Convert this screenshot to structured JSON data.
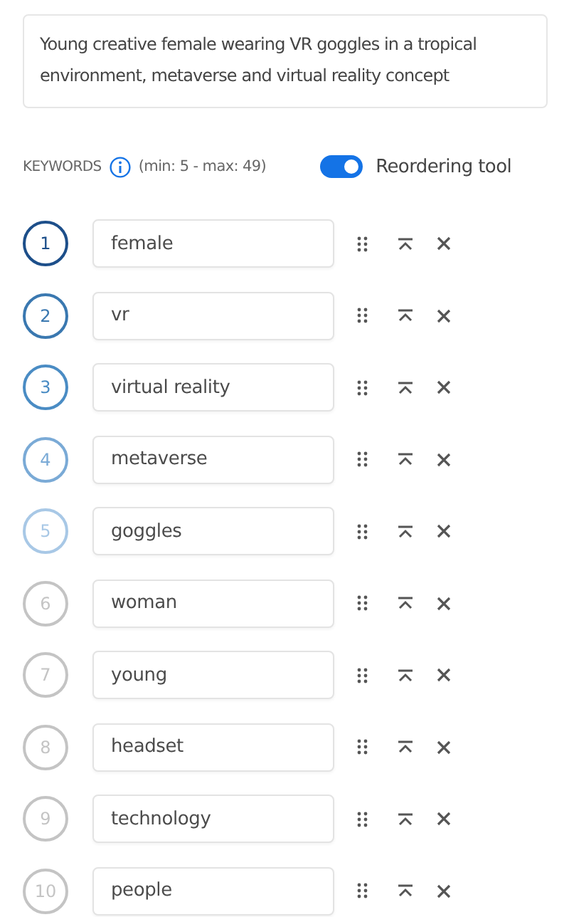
{
  "description": "Young creative female wearing VR goggles in a tropical environment, metaverse and virtual reality concept",
  "keywords_header": {
    "label": "KEYWORDS",
    "limits": "(min: 5 - max: 49)"
  },
  "reordering_tool": {
    "label": "Reordering tool",
    "on": true
  },
  "keywords": [
    {
      "number": "1",
      "value": "female",
      "color": "#1d4f8a"
    },
    {
      "number": "2",
      "value": "vr",
      "color": "#3a78b0"
    },
    {
      "number": "3",
      "value": "virtual reality",
      "color": "#4a8cc4"
    },
    {
      "number": "4",
      "value": "metaverse",
      "color": "#7aaad6"
    },
    {
      "number": "5",
      "value": "goggles",
      "color": "#a8c8e6"
    },
    {
      "number": "6",
      "value": "woman",
      "color": "#c4c4c4"
    },
    {
      "number": "7",
      "value": "young",
      "color": "#c4c4c4"
    },
    {
      "number": "8",
      "value": "headset",
      "color": "#c4c4c4"
    },
    {
      "number": "9",
      "value": "technology",
      "color": "#c4c4c4"
    },
    {
      "number": "10",
      "value": "people",
      "color": "#c4c4c4"
    }
  ]
}
